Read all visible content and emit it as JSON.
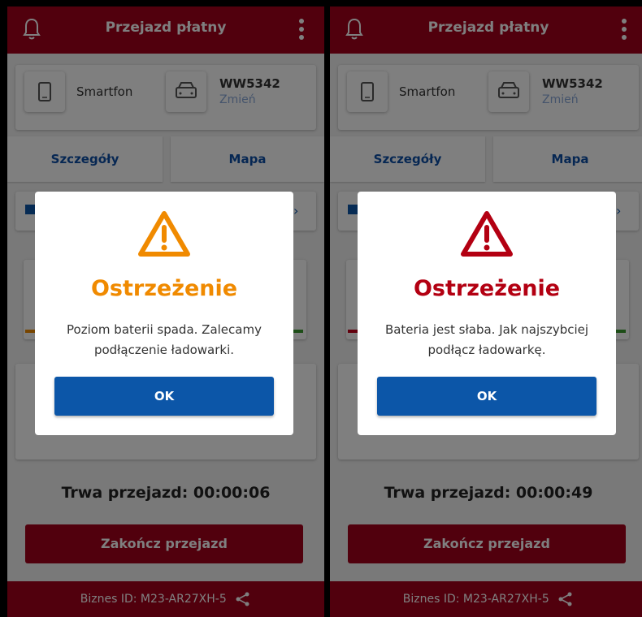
{
  "screens": [
    {
      "header_title": "Przejazd płatny",
      "device_label": "Smartfon",
      "vehicle_plate": "WW5342",
      "vehicle_change": "Zmień",
      "tab_details": "Szczegóły",
      "tab_map": "Mapa",
      "trip_duration": "Trwa przejazd: 00:00:06",
      "end_trip": "Zakończ przejazd",
      "business_id_label": "Biznes ID:",
      "business_id_value": "M23-AR27XH-5",
      "dialog": {
        "title": "Ostrzeżenie",
        "message": "Poziom baterii spada. Zalecamy podłączenie ładowarki.",
        "ok": "OK",
        "color": "#f08a00"
      },
      "stripe_colors": [
        "#f08a00",
        "#3a9a2e"
      ]
    },
    {
      "header_title": "Przejazd płatny",
      "device_label": "Smartfon",
      "vehicle_plate": "WW5342",
      "vehicle_change": "Zmień",
      "tab_details": "Szczegóły",
      "tab_map": "Mapa",
      "trip_duration": "Trwa przejazd: 00:00:49",
      "end_trip": "Zakończ przejazd",
      "business_id_label": "Biznes ID:",
      "business_id_value": "M23-AR27XH-5",
      "dialog": {
        "title": "Ostrzeżenie",
        "message": "Bateria jest słaba. Jak najszybciej podłącz ładowarkę.",
        "ok": "OK",
        "color": "#b30012"
      },
      "stripe_colors": [
        "#c4001b",
        "#3a9a2e"
      ]
    }
  ],
  "colors": {
    "primary_red": "#a3001b",
    "primary_blue": "#0c56a8"
  }
}
